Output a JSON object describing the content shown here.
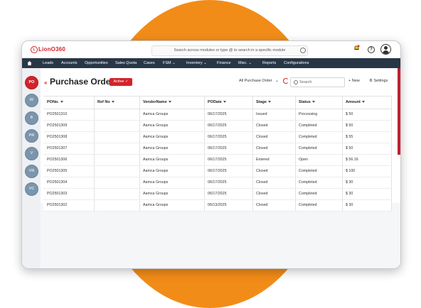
{
  "app": {
    "logo": "LionO360"
  },
  "topbar": {
    "search_placeholder": "Search across modules or type @ to search in a specific module"
  },
  "nav": {
    "items": [
      {
        "label": "Leads"
      },
      {
        "label": "Accounts"
      },
      {
        "label": "Opportunities"
      },
      {
        "label": "Sales Quota"
      },
      {
        "label": "Cases"
      },
      {
        "label": "FSM"
      },
      {
        "label": "Inventory"
      },
      {
        "label": "Finance"
      },
      {
        "label": "Misc."
      },
      {
        "label": "Reports"
      },
      {
        "label": "Configurations"
      }
    ]
  },
  "side": {
    "items": [
      "PO",
      "IR",
      "B",
      "PR",
      "V",
      "VR",
      "VC"
    ]
  },
  "header": {
    "title": "Purchase Order",
    "status": "Active",
    "view": "All Purchase Order",
    "search_placeholder": "Search",
    "new_label": "New",
    "settings_label": "Settings"
  },
  "table": {
    "columns": [
      "PONo.",
      "Ref No",
      "VendorName",
      "PODate",
      "Stage",
      "Status",
      "Amount"
    ],
    "rows": [
      [
        "PO2501310",
        "",
        "Aamca Groups",
        "06/17/2025",
        "Issued",
        "Processing",
        "$ 50"
      ],
      [
        "PO2501309",
        "",
        "Aamca Groups",
        "06/17/2025",
        "Closed",
        "Completed",
        "$ 50"
      ],
      [
        "PO2501308",
        "",
        "Aamca Groups",
        "06/17/2025",
        "Closed",
        "Completed",
        "$ 55"
      ],
      [
        "PO2501307",
        "",
        "Aamca Groups",
        "06/17/2025",
        "Closed",
        "Completed",
        "$ 50"
      ],
      [
        "PO2501306",
        "",
        "Aamca Groups",
        "06/17/2025",
        "Entered",
        "Open",
        "$ 56.16"
      ],
      [
        "PO2501305",
        "",
        "Aamca Groups",
        "06/17/2025",
        "Closed",
        "Completed",
        "$ 100"
      ],
      [
        "PO2501304",
        "",
        "Aamca Groups",
        "06/17/2025",
        "Closed",
        "Completed",
        "$ 30"
      ],
      [
        "PO2501303",
        "",
        "Aamca Groups",
        "06/17/2025",
        "Closed",
        "Completed",
        "$ 30"
      ],
      [
        "PO2501302",
        "",
        "Aamca Groups",
        "06/13/2025",
        "Closed",
        "Completed",
        "$ 30"
      ]
    ]
  },
  "colors": {
    "accent": "#d2232a",
    "nav_bg": "#283746",
    "background_blob": "#f28c18"
  }
}
